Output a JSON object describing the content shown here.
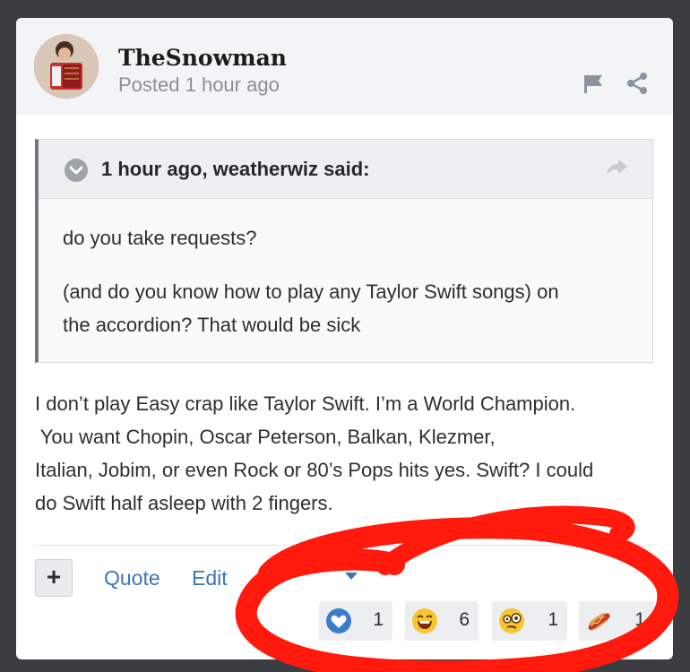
{
  "post": {
    "author": "TheSnowman",
    "posted": "Posted 1 hour ago"
  },
  "icons": {
    "flag": "flag-icon",
    "share": "share-icon",
    "quote_collapse": "chevron-down-icon",
    "quote_share": "reply-arrow-icon"
  },
  "quote": {
    "title": "1 hour ago, weatherwiz said:",
    "lines": [
      "do you take requests?",
      "(and do you know how to play any Taylor Swift songs) on",
      "the accordion? That would be sick"
    ]
  },
  "body": {
    "lines": [
      "I don’t play Easy crap like Taylor Swift.  I’m a World Champion.",
      " You want Chopin, Oscar Peterson, Balkan, Klezmer,",
      "Italian, Jobim, or even Rock or 80’s Pops hits yes.  Swift?  I could",
      "do Swift half asleep with 2 fingers."
    ]
  },
  "actions": {
    "add": "+",
    "quote": "Quote",
    "edit": "Edit",
    "options_fragment": "O"
  },
  "reactions": [
    {
      "name": "like",
      "count": "1"
    },
    {
      "name": "haha",
      "count": "6"
    },
    {
      "name": "confused",
      "count": "1"
    },
    {
      "name": "hotdog",
      "count": "1"
    }
  ],
  "colors": {
    "background": "#3b3d40",
    "link": "#3f74b0",
    "annotation": "#ff1a0d",
    "like_blue": "#3b7cc8"
  }
}
